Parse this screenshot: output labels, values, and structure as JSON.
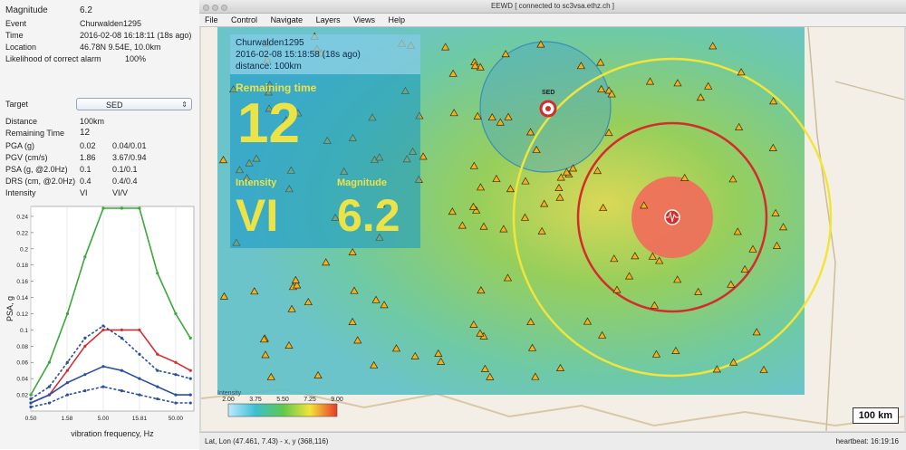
{
  "event_panel": {
    "rows": [
      {
        "label": "Magnitude",
        "value": "6.2",
        "value2": ""
      },
      {
        "label": "Event",
        "value": "Churwalden1295",
        "value2": ""
      },
      {
        "label": "Time",
        "value": "2016-02-08 16:18:11 (18s ago)",
        "value2": ""
      },
      {
        "label": "Location",
        "value": "46.78N 9.54E, 10.0km",
        "value2": ""
      },
      {
        "label": "Likelihood of correct alarm",
        "value": "100%",
        "value2": ""
      }
    ],
    "target_label": "Target",
    "target_value": "SED",
    "target_rows": [
      {
        "label": "Distance",
        "value": "100km",
        "value2": ""
      },
      {
        "label": "Remaining Time",
        "value": "12",
        "value2": ""
      },
      {
        "label": "PGA (g)",
        "value": "0.02",
        "value2": "0.04/0.01"
      },
      {
        "label": "PGV (cm/s)",
        "value": "1.86",
        "value2": "3.67/0.94"
      },
      {
        "label": "PSA (g, @2.0Hz)",
        "value": "0.1",
        "value2": "0.1/0.1"
      },
      {
        "label": "DRS (cm, @2.0Hz)",
        "value": "0.4",
        "value2": "0.4/0.4"
      },
      {
        "label": "Intensity",
        "value": "VI",
        "value2": "VI/V"
      }
    ]
  },
  "chart_data": {
    "type": "line",
    "xlabel": "vibration frequency, Hz",
    "ylabel": "PSA, g",
    "x_ticks": [
      "0.50",
      "1.58",
      "5.00",
      "15.81",
      "50.00"
    ],
    "y_ticks": [
      "0.02",
      "0.04",
      "0.06",
      "0.08",
      "0.1",
      "0.12",
      "0.14",
      "0.16",
      "0.18",
      "0.2",
      "0.22",
      "0.24"
    ],
    "ylim": [
      0,
      0.25
    ],
    "x_log10": [
      -0.301,
      0.199,
      0.699,
      1.199,
      1.699
    ],
    "series": [
      {
        "color": "#3aa83a",
        "style": "solid",
        "x": [
          0.5,
          0.9,
          1.6,
          2.8,
          5.0,
          9.0,
          15.8,
          28.0,
          50.0,
          80.0
        ],
        "y": [
          0.02,
          0.06,
          0.12,
          0.19,
          0.25,
          0.25,
          0.25,
          0.17,
          0.12,
          0.09
        ]
      },
      {
        "color": "#d23030",
        "style": "solid",
        "x": [
          0.5,
          0.9,
          1.6,
          2.8,
          5.0,
          9.0,
          15.8,
          28.0,
          50.0,
          80.0
        ],
        "y": [
          0.01,
          0.02,
          0.05,
          0.08,
          0.1,
          0.1,
          0.1,
          0.07,
          0.06,
          0.05
        ]
      },
      {
        "color": "#2b4fa0",
        "style": "dashed",
        "x": [
          0.5,
          0.9,
          1.6,
          2.8,
          5.0,
          9.0,
          15.8,
          28.0,
          50.0,
          80.0
        ],
        "y": [
          0.015,
          0.03,
          0.06,
          0.09,
          0.105,
          0.09,
          0.07,
          0.05,
          0.045,
          0.04
        ]
      },
      {
        "color": "#2b4fa0",
        "style": "solid",
        "x": [
          0.5,
          0.9,
          1.6,
          2.8,
          5.0,
          9.0,
          15.8,
          28.0,
          50.0,
          80.0
        ],
        "y": [
          0.01,
          0.02,
          0.035,
          0.045,
          0.055,
          0.05,
          0.04,
          0.03,
          0.02,
          0.02
        ]
      },
      {
        "color": "#2b4fa0",
        "style": "dashed",
        "x": [
          0.5,
          0.9,
          1.6,
          2.8,
          5.0,
          9.0,
          15.8,
          28.0,
          50.0,
          80.0
        ],
        "y": [
          0.005,
          0.01,
          0.02,
          0.025,
          0.03,
          0.025,
          0.02,
          0.015,
          0.01,
          0.01
        ]
      }
    ]
  },
  "window": {
    "title": "EEWD [ connected to sc3vsa.ethz.ch ]",
    "menus": [
      "File",
      "Control",
      "Navigate",
      "Layers",
      "Views",
      "Help"
    ]
  },
  "overlay": {
    "event": "Churwalden1295",
    "time": "2016-02-08 15:18:58  (18s ago)",
    "distance": "distance: 100km",
    "remaining_label": "Remaining time",
    "remaining_value": "12",
    "intensity_label": "Intensity",
    "intensity_value": "VI",
    "magnitude_label": "Magnitude",
    "magnitude_value": "6.2"
  },
  "map": {
    "target_label": "SED",
    "scale": "100 km",
    "legend_title": "Intensity",
    "legend_ticks": [
      "2.00",
      "3.75",
      "5.50",
      "7.25",
      "9.00"
    ],
    "colors": {
      "p_wave": "#f0e53a",
      "s_wave": "#d42b2b",
      "target_zone": "#4aa7c8",
      "epicenter": "#f26a5a"
    }
  },
  "statusbar": {
    "coords": "Lat, Lon (47.461, 7.43) - x, y (368,116)",
    "heartbeat": "heartbeat: 16:19:16"
  }
}
